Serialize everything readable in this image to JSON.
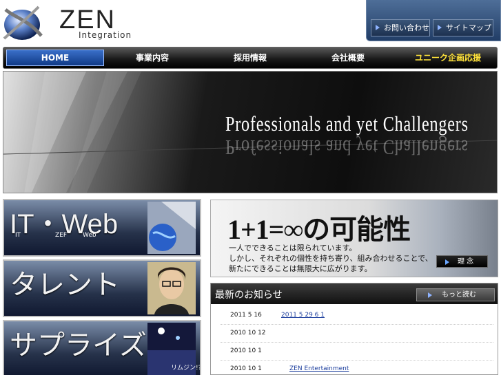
{
  "brand": {
    "name": "ZEN",
    "sub": "Integration"
  },
  "util": {
    "contact": "お問い合わせ",
    "sitemap": "サイトマップ"
  },
  "nav": {
    "items": [
      "HOME",
      "事業内容",
      "採用情報",
      "会社概要",
      "ユニーク企画応援"
    ]
  },
  "hero": {
    "title": "Professionals and yet Challengers"
  },
  "tiles": {
    "it_web": {
      "title": "IT・Web",
      "sub1": "IT",
      "sub2": "ZEF",
      "sub3": "Web"
    },
    "talent": {
      "title": "タレント"
    },
    "surprise": {
      "title": "サプライズ",
      "caption": "リムジン!?"
    }
  },
  "concept": {
    "title": "1+1=∞の可能性",
    "line1": "一人でできることは限られています。",
    "line2": "しかし、それぞれの個性を持ち寄り、組み合わせることで、",
    "line3": "新たにできることは無限大に広がります。",
    "button": "理 念"
  },
  "news": {
    "title": "最新のお知らせ",
    "more": "もっと読む",
    "items": [
      {
        "date": "2011  5 16",
        "link": "2011 5 29  6 1"
      },
      {
        "date": "2010 10 12",
        "link": ""
      },
      {
        "date": "2010 10 1",
        "link": ""
      },
      {
        "date": "2010 10 1",
        "link": "ZEN Entertainment"
      }
    ]
  },
  "colors": {
    "nav_active": "#1e4fa8",
    "nav_highlight": "#ffe23a",
    "link": "#1a3c9c"
  }
}
